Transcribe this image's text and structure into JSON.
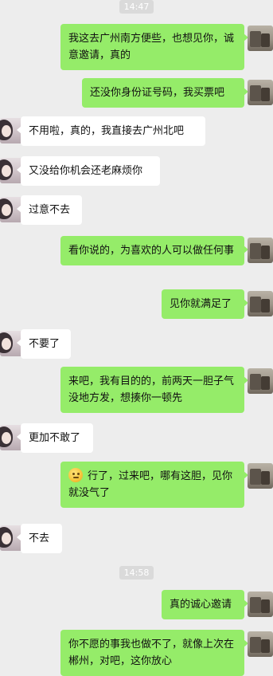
{
  "conversation": {
    "timestamps": [
      "14:47",
      "14:58"
    ],
    "messages": [
      {
        "from": "me",
        "text": "我这去广州南方便些，也想见你，诚意邀请，真的"
      },
      {
        "from": "me",
        "text": "还没你身份证号码，我买票吧"
      },
      {
        "from": "them",
        "text": "不用啦，真的，我直接去广州北吧"
      },
      {
        "from": "them",
        "text": "又没给你机会还老麻烦你"
      },
      {
        "from": "them",
        "text": "过意不去"
      },
      {
        "from": "me",
        "text": "看你说的，为喜欢的人可以做任何事"
      },
      {
        "from": "me",
        "text": "见你就满足了"
      },
      {
        "from": "them",
        "text": "不要了"
      },
      {
        "from": "me",
        "text": "来吧，我有目的的，前两天一胆子气没地方发，想揍你一顿先"
      },
      {
        "from": "them",
        "text": "更加不敢了"
      },
      {
        "from": "me",
        "emoji": "thinking-emoji",
        "text": "行了，过来吧，哪有这胆，见你就没气了"
      },
      {
        "from": "them",
        "text": "不去"
      },
      {
        "from": "me",
        "text": "真的诚心邀请"
      },
      {
        "from": "me",
        "text": "你不愿的事我也做不了，就像上次在郴州，对吧，这你放心"
      }
    ]
  }
}
